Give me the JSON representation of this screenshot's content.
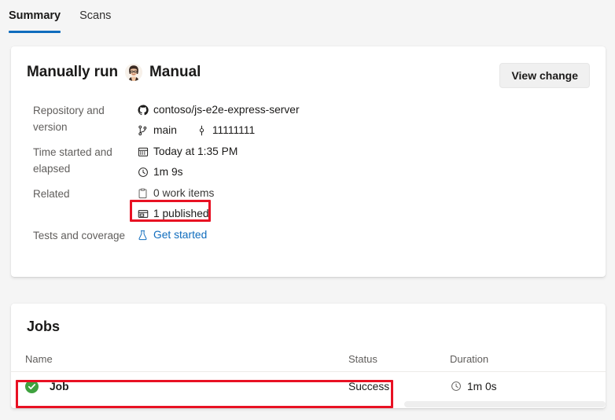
{
  "tabs": [
    {
      "label": "Summary",
      "selected": true
    },
    {
      "label": "Scans",
      "selected": false
    }
  ],
  "colors": {
    "accent": "#0f6cbd",
    "highlight": "#e81123",
    "success": "#3fa23f",
    "page_bg": "#f5f5f5",
    "card_bg": "#ffffff",
    "label_text": "#605e5c"
  },
  "summary": {
    "run_title": "Manually run",
    "actor_name": "Manual",
    "avatar_icon": "person-avatar",
    "view_change_label": "View change",
    "rows": [
      {
        "label": "Repository and version",
        "lines": [
          {
            "icon": "github-icon",
            "text": "contoso/js-e2e-express-server"
          },
          {
            "icon": "branch-icon",
            "text": "main",
            "icon2": "commit-icon",
            "text2": "11111111"
          }
        ]
      },
      {
        "label": "Time started and elapsed",
        "lines": [
          {
            "icon": "calendar-icon",
            "text": "Today at 1:35 PM"
          },
          {
            "icon": "clock-icon",
            "text": "1m 9s"
          }
        ]
      },
      {
        "label": "Related",
        "lines": [
          {
            "icon": "work-items-icon",
            "text": "0 work items"
          },
          {
            "icon": "artifact-published-icon",
            "text": "1 published",
            "highlighted": true
          }
        ]
      },
      {
        "label": "Tests and coverage",
        "lines": [
          {
            "icon": "beaker-icon",
            "link_text": "Get started"
          }
        ]
      }
    ]
  },
  "jobs": {
    "title": "Jobs",
    "columns": {
      "name": "Name",
      "status": "Status",
      "duration": "Duration"
    },
    "rows": [
      {
        "status_icon": "success-check-icon",
        "name": "Job",
        "status": "Success",
        "duration_icon": "clock-icon",
        "duration": "1m 0s",
        "highlighted": true
      }
    ]
  }
}
